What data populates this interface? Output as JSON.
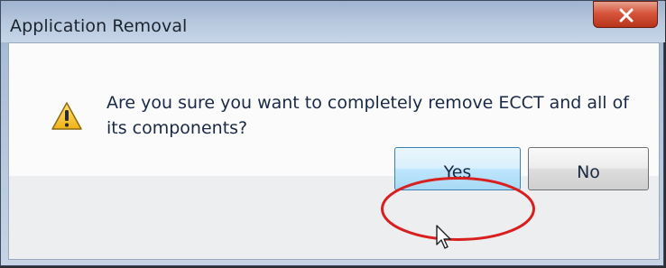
{
  "dialog": {
    "title": "Application Removal",
    "message": "Are you sure you want to completely remove ECCT and all of its components?",
    "icon": "warning-icon",
    "buttons": {
      "yes_label": "Yes",
      "no_label": "No"
    }
  },
  "colors": {
    "annotation_circle": "#d8201f",
    "accent_button": "#3c7fb1"
  }
}
